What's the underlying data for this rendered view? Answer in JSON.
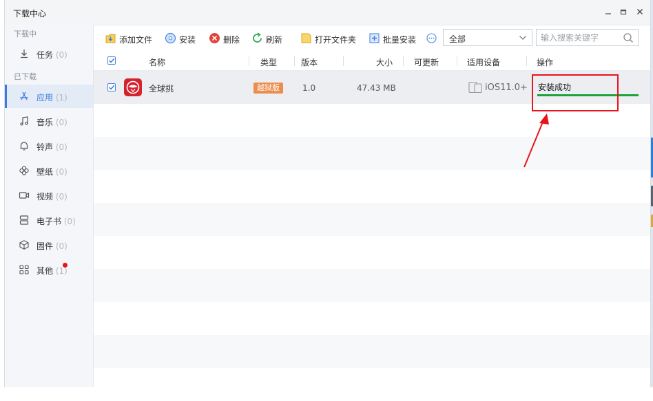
{
  "window": {
    "title": "下载中心"
  },
  "sidebar": {
    "sections": {
      "downloading": "下载中",
      "downloaded": "已下载"
    },
    "items": [
      {
        "key": "tasks",
        "label": "任务",
        "count": "(0)"
      },
      {
        "key": "apps",
        "label": "应用",
        "count": "(1)",
        "active": true
      },
      {
        "key": "music",
        "label": "音乐",
        "count": "(0)"
      },
      {
        "key": "ringtones",
        "label": "铃声",
        "count": "(0)"
      },
      {
        "key": "wallpapers",
        "label": "壁纸",
        "count": "(0)"
      },
      {
        "key": "videos",
        "label": "视频",
        "count": "(0)"
      },
      {
        "key": "ebooks",
        "label": "电子书",
        "count": "(0)"
      },
      {
        "key": "firmware",
        "label": "固件",
        "count": "(0)"
      },
      {
        "key": "other",
        "label": "其他",
        "count": "(1)",
        "has_dot": true
      }
    ]
  },
  "toolbar": {
    "add_file": "添加文件",
    "install": "安装",
    "delete": "删除",
    "refresh": "刷新",
    "open_folder": "打开文件夹",
    "batch_install": "批量安装",
    "filter": {
      "selected": "全部"
    },
    "search": {
      "placeholder": "输入搜索关键字"
    }
  },
  "table": {
    "columns": {
      "name": "名称",
      "type": "类型",
      "version": "版本",
      "size": "大小",
      "updatable": "可更新",
      "device": "适用设备",
      "action": "操作"
    },
    "rows": [
      {
        "name": "全球挑",
        "type_badge": "越狱版",
        "version": "1.0",
        "size": "47.43 MB",
        "updatable": "",
        "device": "iOS11.0+",
        "status": "安装成功",
        "progress": 1.0,
        "checked": true
      }
    ]
  },
  "colors": {
    "accent": "#3d7ae0",
    "badge": "#ec8c4d",
    "progress": "#1aa33a",
    "annotation": "#e8141b",
    "app_icon": "#d5232d"
  }
}
